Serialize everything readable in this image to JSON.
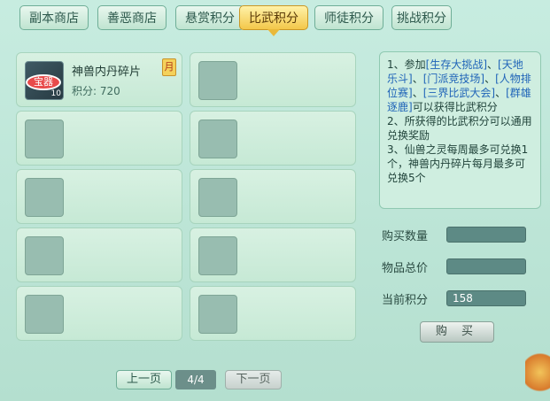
{
  "tabs": [
    {
      "label": "副本商店"
    },
    {
      "label": "善恶商店"
    },
    {
      "label": "悬赏积分"
    },
    {
      "label": "比武积分",
      "active": true
    },
    {
      "label": "师徒积分"
    },
    {
      "label": "挑战积分"
    }
  ],
  "item": {
    "name": "神兽内丹碎片",
    "price": "积分: 720",
    "badge_text": "宝器",
    "stack_count": "10",
    "limit_badge": "月"
  },
  "info": {
    "lines": [
      [
        "1、参加",
        "[生存大挑战]",
        "、",
        "[天地乐斗]",
        "、",
        "[门派竞技场]",
        "、",
        "[人物排位赛]",
        "、",
        "[三界比武大会]",
        "、",
        "[群雄逐鹿]",
        "可以获得比武积分"
      ],
      "2、所获得的比武积分可以通用兑换奖励",
      "3、仙兽之灵每周最多可兑换1个，神兽内丹碎片每月最多可兑换5个"
    ]
  },
  "purchase": {
    "qty_label": "购买数量",
    "qty_value": "",
    "total_label": "物品总价",
    "total_value": "",
    "points_label": "当前积分",
    "points_value": "158",
    "buy_label": "购 买"
  },
  "pager": {
    "prev": "上一页",
    "page": "4/4",
    "next": "下一页"
  }
}
